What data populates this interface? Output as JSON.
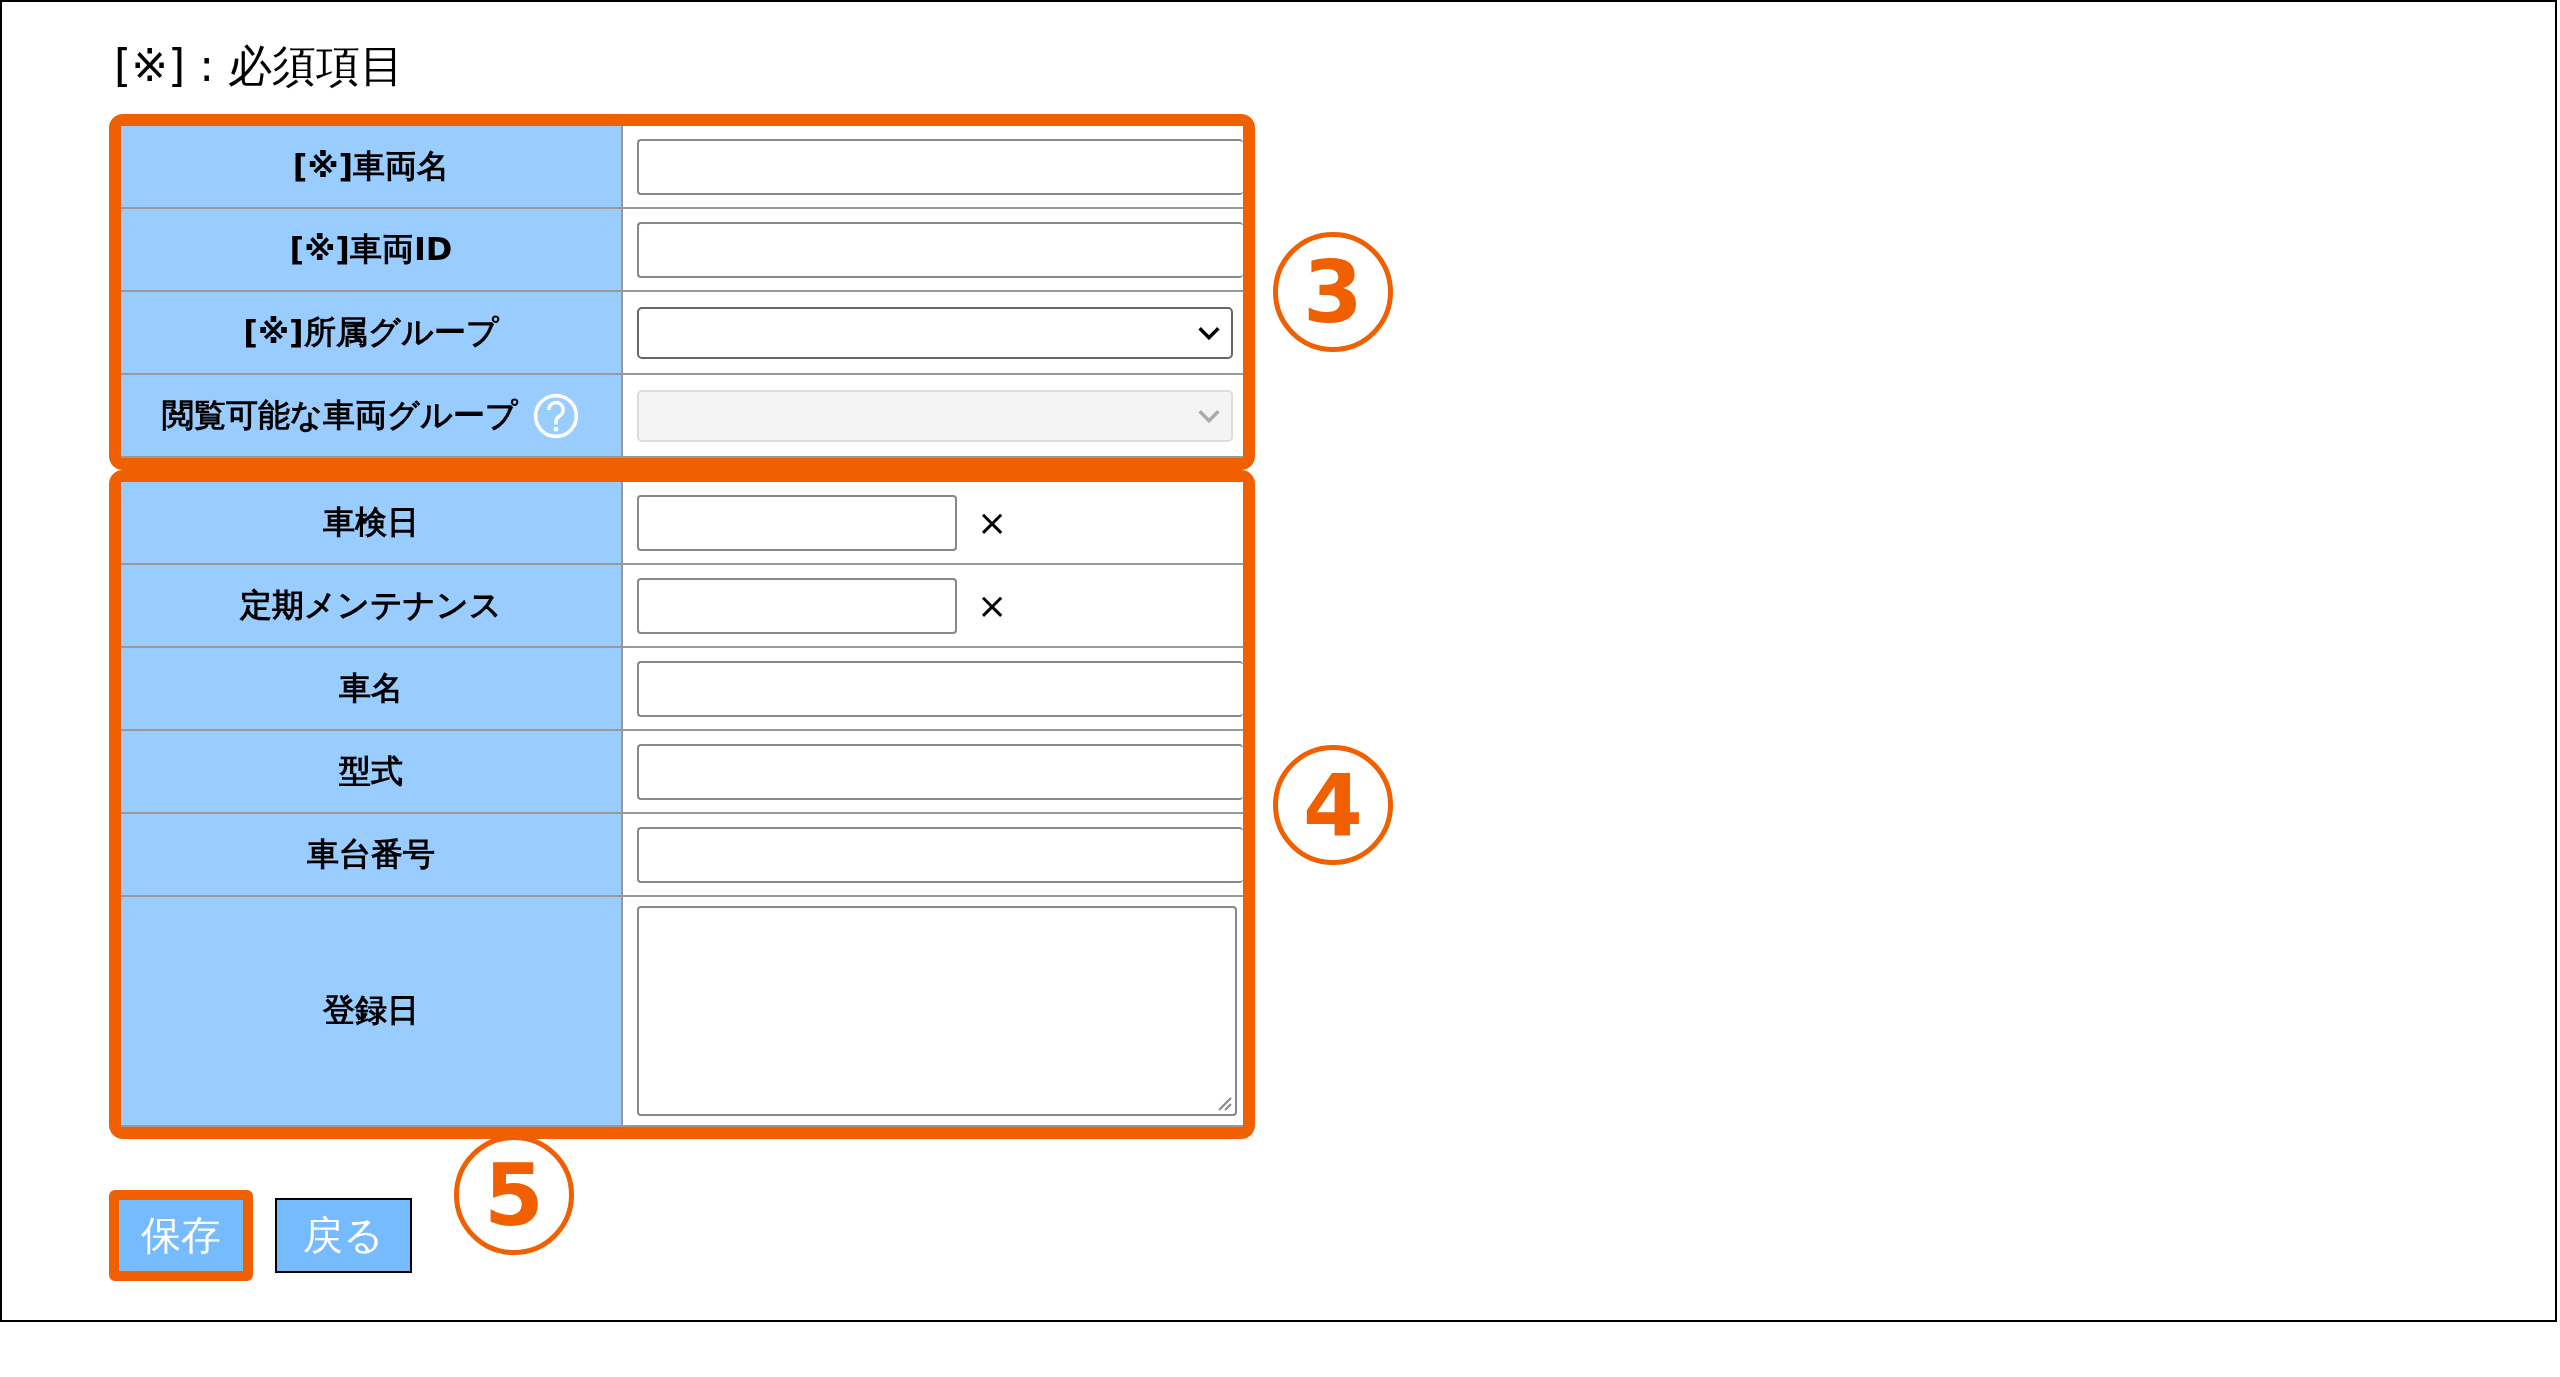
{
  "note": "[※] : 必須項目",
  "sections": [
    {
      "marker": "3",
      "rows": [
        {
          "label": "[※]車両名",
          "kind": "text"
        },
        {
          "label": "[※]車両ID",
          "kind": "text"
        },
        {
          "label": "[※]所属グループ",
          "kind": "select",
          "disabled": false
        },
        {
          "label": "閲覧可能な車両グループ",
          "kind": "select",
          "disabled": true,
          "help": true
        }
      ]
    },
    {
      "marker": "4",
      "rows": [
        {
          "label": "車検日",
          "kind": "date",
          "clear": "×"
        },
        {
          "label": "定期メンテナンス",
          "kind": "date",
          "clear": "×"
        },
        {
          "label": "車名",
          "kind": "text"
        },
        {
          "label": "型式",
          "kind": "text"
        },
        {
          "label": "車台番号",
          "kind": "text"
        },
        {
          "label": "登録日",
          "kind": "textarea"
        }
      ]
    }
  ],
  "buttons": [
    {
      "label": "保存",
      "highlighted": true
    },
    {
      "label": "戻る",
      "highlighted": false
    }
  ],
  "buttons_marker": "5"
}
